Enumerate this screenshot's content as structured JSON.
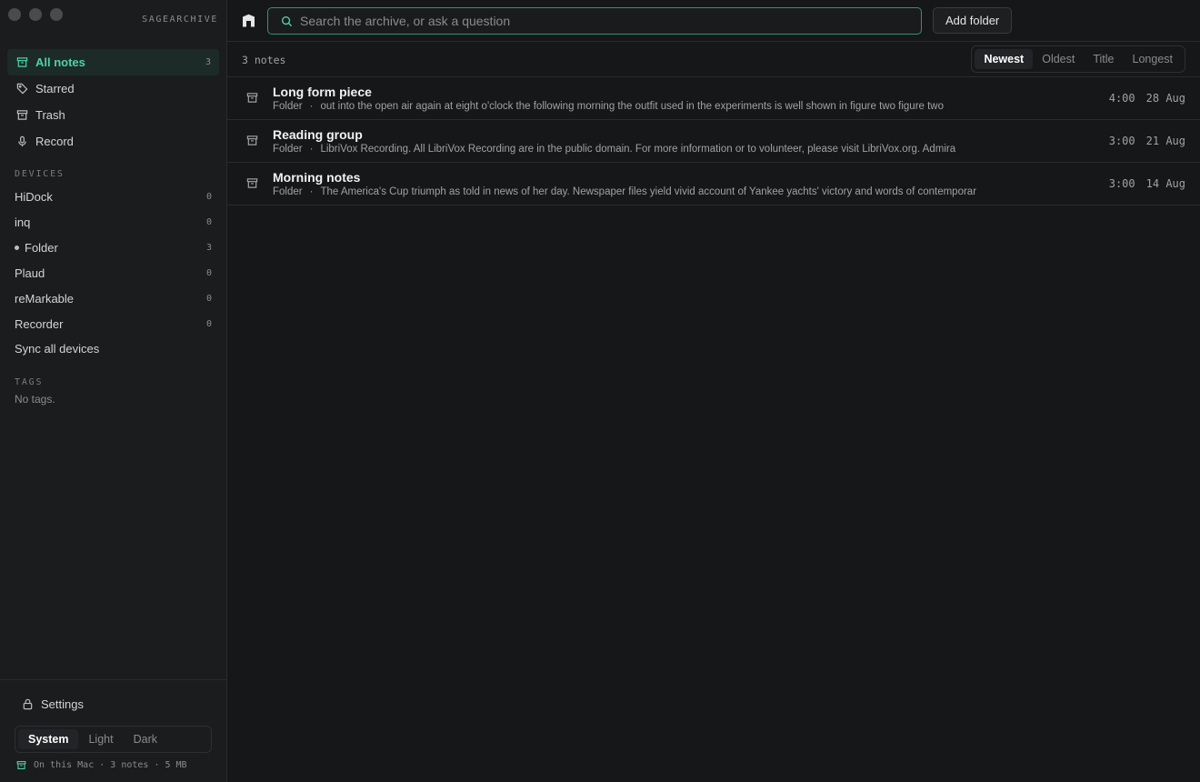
{
  "app": {
    "brand": "SAGEARCHIVE"
  },
  "colors": {
    "accent": "#4fd1a5",
    "background": "#161718",
    "sidebar": "#1b1c1e"
  },
  "sidebar": {
    "nav": [
      {
        "label": "All notes",
        "count": "3",
        "icon": "archive-icon",
        "active": true
      },
      {
        "label": "Starred",
        "count": "",
        "icon": "tag-icon"
      },
      {
        "label": "Trash",
        "count": "",
        "icon": "archive-icon"
      },
      {
        "label": "Record",
        "count": "",
        "icon": "microphone-icon"
      }
    ],
    "devices_title": "DEVICES",
    "devices": [
      {
        "label": "HiDock",
        "count": "0"
      },
      {
        "label": "inq",
        "count": "0"
      },
      {
        "label": "Folder",
        "count": "3",
        "dot": true
      },
      {
        "label": "Plaud",
        "count": "0"
      },
      {
        "label": "reMarkable",
        "count": "0"
      },
      {
        "label": "Recorder",
        "count": "0"
      }
    ],
    "sync_label": "Sync all devices",
    "tags_title": "TAGS",
    "no_tags": "No tags.",
    "settings_label": "Settings",
    "theme_options": [
      "System",
      "Light",
      "Dark"
    ],
    "storage": "On this Mac · 3 notes · 5 MB"
  },
  "search": {
    "placeholder": "Search the archive, or ask a question",
    "value": ""
  },
  "toolbar": {
    "add_folder": "Add folder"
  },
  "list": {
    "count": "3 notes",
    "sort_options": [
      "Newest",
      "Oldest",
      "Title",
      "Longest"
    ],
    "notes": [
      {
        "title": "Long form piece",
        "folder": "Folder",
        "snippet": "out into the open air again at eight o'clock the following morning the outfit used in the experiments is well shown in figure two figure two",
        "duration": "4:00",
        "date": "28 Aug"
      },
      {
        "title": "Reading group",
        "folder": "Folder",
        "snippet": "LibriVox Recording. All LibriVox Recording are in the public domain. For more information or to volunteer, please visit LibriVox.org. Admira",
        "duration": "3:00",
        "date": "21 Aug"
      },
      {
        "title": "Morning notes",
        "folder": "Folder",
        "snippet": "The America's Cup triumph as told in news of her day. Newspaper files yield vivid account of Yankee yachts' victory and words of contemporar",
        "duration": "3:00",
        "date": "14 Aug"
      }
    ]
  }
}
